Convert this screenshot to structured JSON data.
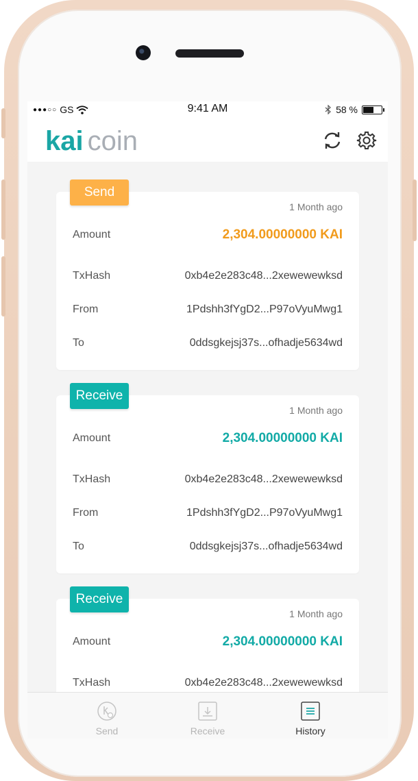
{
  "status_bar": {
    "carrier": "GS",
    "time": "9:41 AM",
    "battery": "58 %",
    "battery_level": 0.58
  },
  "app": {
    "logo_primary": "kai",
    "logo_secondary": "coin",
    "refresh_icon": "refresh-icon",
    "settings_icon": "gear-icon"
  },
  "labels": {
    "amount": "Amount",
    "txhash": "TxHash",
    "from": "From",
    "to": "To"
  },
  "transactions": [
    {
      "type": "Send",
      "time_ago": "1 Month ago",
      "amount": "2,304.00000000 KAI",
      "txhash": "0xb4e2e283c48...2xewewewksd",
      "from": "1Pdshh3fYgD2...P97oVyuMwg1",
      "to": "0ddsgkejsj37s...ofhadje5634wd"
    },
    {
      "type": "Receive",
      "time_ago": "1 Month ago",
      "amount": "2,304.00000000 KAI",
      "txhash": "0xb4e2e283c48...2xewewewksd",
      "from": "1Pdshh3fYgD2...P97oVyuMwg1",
      "to": "0ddsgkejsj37s...ofhadje5634wd"
    },
    {
      "type": "Receive",
      "time_ago": "1 Month ago",
      "amount": "2,304.00000000 KAI",
      "txhash": "0xb4e2e283c48...2xewewewksd"
    }
  ],
  "tabs": [
    {
      "label": "Send",
      "icon": "send-icon",
      "active": false
    },
    {
      "label": "Receive",
      "icon": "receive-icon",
      "active": false
    },
    {
      "label": "History",
      "icon": "history-icon",
      "active": true
    }
  ],
  "colors": {
    "brand_teal": "#1aa6a5",
    "send_orange": "#fdb148",
    "receive_teal": "#0fb3ab"
  }
}
